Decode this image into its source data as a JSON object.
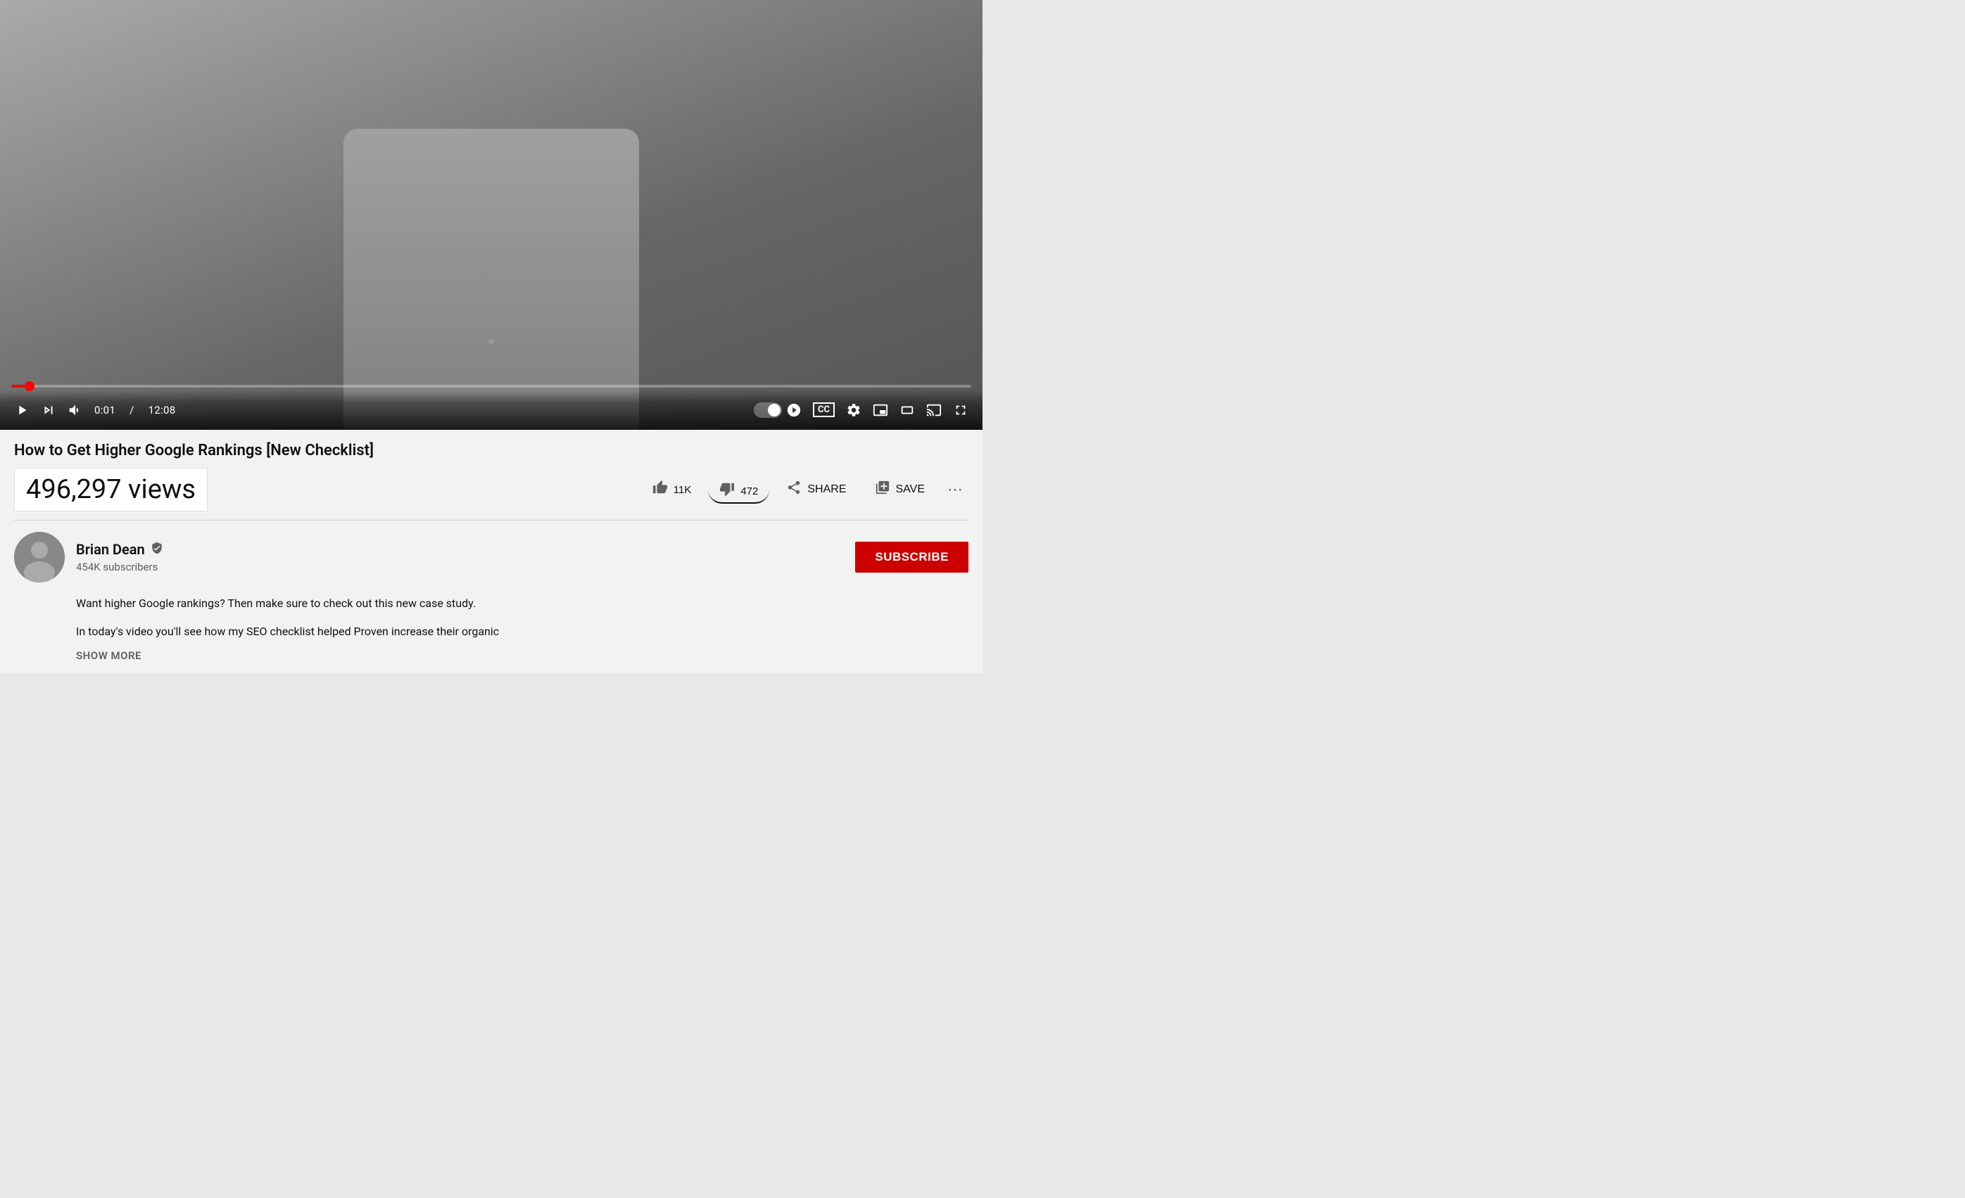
{
  "video": {
    "title": "How to Get Higher Google Rankings [New Checklist]",
    "views": "496,297 views",
    "time_current": "0:01",
    "time_total": "12:08",
    "progress_percent": 2
  },
  "controls": {
    "play_label": "▶",
    "next_label": "⏭",
    "volume_label": "🔊",
    "time_display": "0:01 / 12:08",
    "autoplay_label": "",
    "cc_label": "CC",
    "settings_label": "⚙",
    "miniplayer_label": "⧉",
    "theater_label": "▭",
    "cast_label": "📺",
    "fullscreen_label": "⛶"
  },
  "actions": {
    "like_count": "11K",
    "dislike_count": "472",
    "share_label": "SHARE",
    "save_label": "SAVE",
    "more_label": "•••"
  },
  "channel": {
    "name": "Brian Dean",
    "subscribers": "454K subscribers",
    "subscribe_label": "SUBSCRIBE"
  },
  "description": {
    "line1": "Want higher Google rankings? Then make sure to check out this new case study.",
    "line2": "In today's video you'll see how my SEO checklist helped Proven increase their organic",
    "show_more": "SHOW MORE"
  }
}
